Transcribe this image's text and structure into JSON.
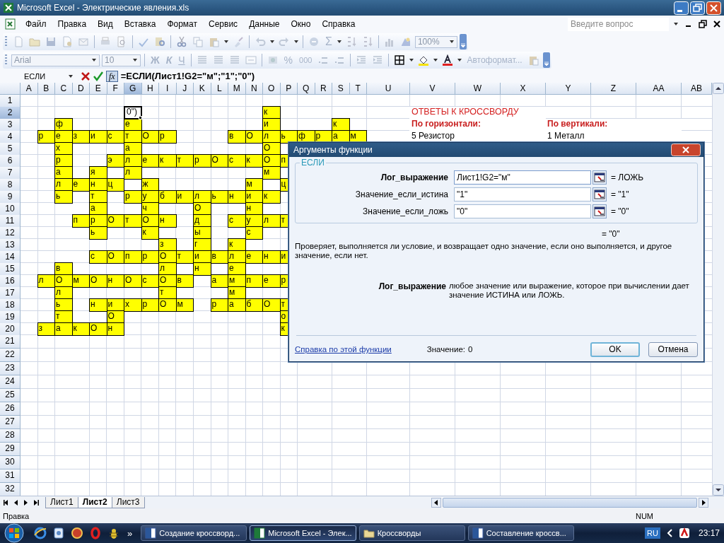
{
  "window": {
    "title": "Microsoft Excel - Электрические явления.xls"
  },
  "menu": {
    "items": [
      "Файл",
      "Правка",
      "Вид",
      "Вставка",
      "Формат",
      "Сервис",
      "Данные",
      "Окно",
      "Справка"
    ],
    "question_box": {
      "placeholder": "Введите вопрос"
    }
  },
  "standard_toolbar": {
    "disabled": true,
    "sigma": "Σ",
    "zoom": "100%"
  },
  "formatting_toolbar": {
    "disabled": true,
    "font": "Arial",
    "size": "10",
    "bold": "Ж",
    "italic": "К",
    "underline": "Ч",
    "percent": "%",
    "thousands": "000",
    "autoformat": "Автоформат..."
  },
  "formula_bar": {
    "name_box": "ЕСЛИ",
    "fx": "fx",
    "formula": "=ЕСЛИ(Лист1!G2=\"м\";\"1\";\"0\")"
  },
  "sheet": {
    "columns": [
      "A",
      "B",
      "C",
      "D",
      "E",
      "F",
      "G",
      "H",
      "I",
      "J",
      "K",
      "L",
      "M",
      "N",
      "O",
      "P",
      "Q",
      "R",
      "S",
      "T",
      "U",
      "V",
      "W",
      "X",
      "Y",
      "Z",
      "AA",
      "AB"
    ],
    "rows": [
      {
        "label": "1"
      },
      {
        "label": "2",
        "cells": [
          {
            "kind": "blank"
          },
          {
            "kind": "blank"
          },
          {
            "kind": "blank"
          },
          {
            "kind": "blank"
          },
          {
            "kind": "blank"
          },
          {
            "kind": "blank"
          },
          {
            "kind": "active",
            "text": "0\")"
          },
          {
            "kind": "blank"
          },
          {
            "kind": "blank"
          },
          {
            "kind": "blank"
          },
          {
            "kind": "blank"
          },
          {
            "kind": "blank"
          },
          {
            "kind": "blank"
          },
          {
            "kind": "blank"
          },
          {
            "kind": "letter",
            "text": "к"
          },
          {
            "kind": "blank"
          },
          {
            "kind": "blank"
          },
          {
            "kind": "blank"
          },
          {
            "kind": "blank"
          },
          {
            "kind": "blank"
          },
          {
            "kind": "blank"
          },
          {
            "kind": "title",
            "text": "ОТВЕТЫ К КРОССВОРДУ"
          }
        ]
      },
      {
        "label": "3",
        "cells": [
          {
            "kind": "blank"
          },
          {
            "kind": "blank"
          },
          {
            "kind": "letter",
            "text": "ф"
          },
          {
            "kind": "blank"
          },
          {
            "kind": "blank"
          },
          {
            "kind": "blank"
          },
          {
            "kind": "letter",
            "text": "е"
          },
          {
            "kind": "blank"
          },
          {
            "kind": "blank"
          },
          {
            "kind": "blank"
          },
          {
            "kind": "blank"
          },
          {
            "kind": "blank"
          },
          {
            "kind": "blank"
          },
          {
            "kind": "blank"
          },
          {
            "kind": "letter",
            "text": "и"
          },
          {
            "kind": "blank"
          },
          {
            "kind": "blank"
          },
          {
            "kind": "blank"
          },
          {
            "kind": "letter",
            "text": "к"
          },
          {
            "kind": "blank"
          },
          {
            "kind": "blank"
          },
          {
            "kind": "heading",
            "text": "По горизонтали:"
          },
          {
            "kind": "blank"
          },
          {
            "kind": "blank"
          },
          {
            "kind": "heading",
            "text": "По вертикали:"
          }
        ]
      },
      {
        "label": "4",
        "cells": [
          {
            "kind": "blank"
          },
          {
            "kind": "letter",
            "text": "р"
          },
          {
            "kind": "letter",
            "text": "е"
          },
          {
            "kind": "letter",
            "text": "з"
          },
          {
            "kind": "letter",
            "text": "и"
          },
          {
            "kind": "letter",
            "text": "с"
          },
          {
            "kind": "letter",
            "text": "т"
          },
          {
            "kind": "letter",
            "text": "О"
          },
          {
            "kind": "letter",
            "text": "р"
          },
          {
            "kind": "blank"
          },
          {
            "kind": "blank"
          },
          {
            "kind": "blank"
          },
          {
            "kind": "letter",
            "text": "в"
          },
          {
            "kind": "letter",
            "text": "О"
          },
          {
            "kind": "letter",
            "text": "л"
          },
          {
            "kind": "letter",
            "text": "ь"
          },
          {
            "kind": "letter",
            "text": "ф"
          },
          {
            "kind": "letter",
            "text": "р"
          },
          {
            "kind": "letter",
            "text": "а"
          },
          {
            "kind": "letter",
            "text": "м"
          },
          {
            "kind": "blank"
          },
          {
            "kind": "plain",
            "text": "5 Резистор"
          },
          {
            "kind": "blank"
          },
          {
            "kind": "blank"
          },
          {
            "kind": "plain",
            "text": "1 Металл"
          }
        ]
      },
      {
        "label": "5",
        "cells": [
          {
            "kind": "blank"
          },
          {
            "kind": "blank"
          },
          {
            "kind": "letter",
            "text": "х"
          },
          {
            "kind": "blank"
          },
          {
            "kind": "blank"
          },
          {
            "kind": "blank"
          },
          {
            "kind": "letter",
            "text": "а"
          },
          {
            "kind": "blank"
          },
          {
            "kind": "blank"
          },
          {
            "kind": "blank"
          },
          {
            "kind": "blank"
          },
          {
            "kind": "blank"
          },
          {
            "kind": "blank"
          },
          {
            "kind": "blank"
          },
          {
            "kind": "letter",
            "text": "О"
          }
        ]
      },
      {
        "label": "6",
        "cells": [
          {
            "kind": "blank"
          },
          {
            "kind": "blank"
          },
          {
            "kind": "letter",
            "text": "р"
          },
          {
            "kind": "blank"
          },
          {
            "kind": "blank"
          },
          {
            "kind": "letter",
            "text": "э"
          },
          {
            "kind": "letter",
            "text": "л"
          },
          {
            "kind": "letter",
            "text": "е"
          },
          {
            "kind": "letter",
            "text": "к"
          },
          {
            "kind": "letter",
            "text": "т"
          },
          {
            "kind": "letter",
            "text": "р"
          },
          {
            "kind": "letter",
            "text": "О"
          },
          {
            "kind": "letter",
            "text": "с"
          },
          {
            "kind": "letter",
            "text": "к"
          },
          {
            "kind": "letter",
            "text": "О"
          },
          {
            "kind": "letter",
            "text": "п"
          }
        ]
      },
      {
        "label": "7",
        "cells": [
          {
            "kind": "blank"
          },
          {
            "kind": "blank"
          },
          {
            "kind": "letter",
            "text": "а"
          },
          {
            "kind": "blank"
          },
          {
            "kind": "letter",
            "text": "я"
          },
          {
            "kind": "blank"
          },
          {
            "kind": "letter",
            "text": "л"
          },
          {
            "kind": "blank"
          },
          {
            "kind": "blank"
          },
          {
            "kind": "blank"
          },
          {
            "kind": "blank"
          },
          {
            "kind": "blank"
          },
          {
            "kind": "blank"
          },
          {
            "kind": "blank"
          },
          {
            "kind": "letter",
            "text": "м"
          }
        ]
      },
      {
        "label": "8",
        "cells": [
          {
            "kind": "blank"
          },
          {
            "kind": "blank"
          },
          {
            "kind": "letter",
            "text": "л"
          },
          {
            "kind": "letter",
            "text": "е"
          },
          {
            "kind": "letter",
            "text": "н"
          },
          {
            "kind": "letter",
            "text": "ц"
          },
          {
            "kind": "blank"
          },
          {
            "kind": "letter",
            "text": "ж"
          },
          {
            "kind": "blank"
          },
          {
            "kind": "blank"
          },
          {
            "kind": "blank"
          },
          {
            "kind": "blank"
          },
          {
            "kind": "blank"
          },
          {
            "kind": "letter",
            "text": "м"
          },
          {
            "kind": "blank"
          },
          {
            "kind": "letter",
            "text": "ц"
          }
        ]
      },
      {
        "label": "9",
        "cells": [
          {
            "kind": "blank"
          },
          {
            "kind": "blank"
          },
          {
            "kind": "letter",
            "text": "ь"
          },
          {
            "kind": "blank"
          },
          {
            "kind": "letter",
            "text": "т"
          },
          {
            "kind": "blank"
          },
          {
            "kind": "letter",
            "text": "р"
          },
          {
            "kind": "letter",
            "text": "у"
          },
          {
            "kind": "letter",
            "text": "б"
          },
          {
            "kind": "letter",
            "text": "и"
          },
          {
            "kind": "letter",
            "text": "л"
          },
          {
            "kind": "letter",
            "text": "ь"
          },
          {
            "kind": "letter",
            "text": "н"
          },
          {
            "kind": "letter",
            "text": "и"
          },
          {
            "kind": "letter",
            "text": "к"
          }
        ]
      },
      {
        "label": "10",
        "cells": [
          {
            "kind": "blank"
          },
          {
            "kind": "blank"
          },
          {
            "kind": "blank"
          },
          {
            "kind": "blank"
          },
          {
            "kind": "letter",
            "text": "а"
          },
          {
            "kind": "blank"
          },
          {
            "kind": "blank"
          },
          {
            "kind": "letter",
            "text": "ч"
          },
          {
            "kind": "blank"
          },
          {
            "kind": "blank"
          },
          {
            "kind": "letter",
            "text": "О"
          },
          {
            "kind": "blank"
          },
          {
            "kind": "blank"
          },
          {
            "kind": "letter",
            "text": "н"
          }
        ]
      },
      {
        "label": "11",
        "cells": [
          {
            "kind": "blank"
          },
          {
            "kind": "blank"
          },
          {
            "kind": "blank"
          },
          {
            "kind": "letter",
            "text": "п"
          },
          {
            "kind": "letter",
            "text": "р"
          },
          {
            "kind": "letter",
            "text": "О"
          },
          {
            "kind": "letter",
            "text": "т"
          },
          {
            "kind": "letter",
            "text": "О"
          },
          {
            "kind": "letter",
            "text": "н"
          },
          {
            "kind": "blank"
          },
          {
            "kind": "letter",
            "text": "д"
          },
          {
            "kind": "blank"
          },
          {
            "kind": "letter",
            "text": "с"
          },
          {
            "kind": "letter",
            "text": "у"
          },
          {
            "kind": "letter",
            "text": "л"
          },
          {
            "kind": "letter",
            "text": "т"
          }
        ]
      },
      {
        "label": "12",
        "cells": [
          {
            "kind": "blank"
          },
          {
            "kind": "blank"
          },
          {
            "kind": "blank"
          },
          {
            "kind": "blank"
          },
          {
            "kind": "letter",
            "text": "ь"
          },
          {
            "kind": "blank"
          },
          {
            "kind": "blank"
          },
          {
            "kind": "letter",
            "text": "к"
          },
          {
            "kind": "blank"
          },
          {
            "kind": "blank"
          },
          {
            "kind": "letter",
            "text": "ы"
          },
          {
            "kind": "blank"
          },
          {
            "kind": "blank"
          },
          {
            "kind": "letter",
            "text": "с"
          }
        ]
      },
      {
        "label": "13",
        "cells": [
          {
            "kind": "blank"
          },
          {
            "kind": "blank"
          },
          {
            "kind": "blank"
          },
          {
            "kind": "blank"
          },
          {
            "kind": "blank"
          },
          {
            "kind": "blank"
          },
          {
            "kind": "blank"
          },
          {
            "kind": "blank"
          },
          {
            "kind": "letter",
            "text": "з"
          },
          {
            "kind": "blank"
          },
          {
            "kind": "letter",
            "text": "г"
          },
          {
            "kind": "blank"
          },
          {
            "kind": "letter",
            "text": "к"
          }
        ]
      },
      {
        "label": "14",
        "cells": [
          {
            "kind": "blank"
          },
          {
            "kind": "blank"
          },
          {
            "kind": "blank"
          },
          {
            "kind": "blank"
          },
          {
            "kind": "letter",
            "text": "с"
          },
          {
            "kind": "letter",
            "text": "О"
          },
          {
            "kind": "letter",
            "text": "п"
          },
          {
            "kind": "letter",
            "text": "р"
          },
          {
            "kind": "letter",
            "text": "О"
          },
          {
            "kind": "letter",
            "text": "т"
          },
          {
            "kind": "letter",
            "text": "и"
          },
          {
            "kind": "letter",
            "text": "в"
          },
          {
            "kind": "letter",
            "text": "л"
          },
          {
            "kind": "letter",
            "text": "е"
          },
          {
            "kind": "letter",
            "text": "н"
          },
          {
            "kind": "letter",
            "text": "и"
          }
        ]
      },
      {
        "label": "15",
        "cells": [
          {
            "kind": "blank"
          },
          {
            "kind": "blank"
          },
          {
            "kind": "letter",
            "text": "в"
          },
          {
            "kind": "blank"
          },
          {
            "kind": "blank"
          },
          {
            "kind": "blank"
          },
          {
            "kind": "blank"
          },
          {
            "kind": "blank"
          },
          {
            "kind": "letter",
            "text": "л"
          },
          {
            "kind": "blank"
          },
          {
            "kind": "letter",
            "text": "н"
          },
          {
            "kind": "blank"
          },
          {
            "kind": "letter",
            "text": "е"
          }
        ]
      },
      {
        "label": "16",
        "cells": [
          {
            "kind": "blank"
          },
          {
            "kind": "letter",
            "text": "л"
          },
          {
            "kind": "letter",
            "text": "О"
          },
          {
            "kind": "letter",
            "text": "м"
          },
          {
            "kind": "letter",
            "text": "О"
          },
          {
            "kind": "letter",
            "text": "н"
          },
          {
            "kind": "letter",
            "text": "О"
          },
          {
            "kind": "letter",
            "text": "с"
          },
          {
            "kind": "letter",
            "text": "О"
          },
          {
            "kind": "letter",
            "text": "в"
          },
          {
            "kind": "blank"
          },
          {
            "kind": "letter",
            "text": "а"
          },
          {
            "kind": "letter",
            "text": "м"
          },
          {
            "kind": "letter",
            "text": "п"
          },
          {
            "kind": "letter",
            "text": "е"
          },
          {
            "kind": "letter",
            "text": "р"
          }
        ]
      },
      {
        "label": "17",
        "cells": [
          {
            "kind": "blank"
          },
          {
            "kind": "blank"
          },
          {
            "kind": "letter",
            "text": "л"
          },
          {
            "kind": "blank"
          },
          {
            "kind": "blank"
          },
          {
            "kind": "blank"
          },
          {
            "kind": "blank"
          },
          {
            "kind": "blank"
          },
          {
            "kind": "letter",
            "text": "т"
          },
          {
            "kind": "blank"
          },
          {
            "kind": "blank"
          },
          {
            "kind": "blank"
          },
          {
            "kind": "letter",
            "text": "м"
          }
        ]
      },
      {
        "label": "18",
        "cells": [
          {
            "kind": "blank"
          },
          {
            "kind": "blank"
          },
          {
            "kind": "letter",
            "text": "ь"
          },
          {
            "kind": "blank"
          },
          {
            "kind": "letter",
            "text": "н"
          },
          {
            "kind": "letter",
            "text": "и"
          },
          {
            "kind": "letter",
            "text": "х"
          },
          {
            "kind": "letter",
            "text": "р"
          },
          {
            "kind": "letter",
            "text": "О"
          },
          {
            "kind": "letter",
            "text": "м"
          },
          {
            "kind": "blank"
          },
          {
            "kind": "letter",
            "text": "р"
          },
          {
            "kind": "letter",
            "text": "а"
          },
          {
            "kind": "letter",
            "text": "б"
          },
          {
            "kind": "letter",
            "text": "О"
          },
          {
            "kind": "letter",
            "text": "т"
          }
        ]
      },
      {
        "label": "19",
        "cells": [
          {
            "kind": "blank"
          },
          {
            "kind": "blank"
          },
          {
            "kind": "letter",
            "text": "т"
          },
          {
            "kind": "blank"
          },
          {
            "kind": "blank"
          },
          {
            "kind": "letter",
            "text": "О"
          },
          {
            "kind": "blank"
          },
          {
            "kind": "blank"
          },
          {
            "kind": "blank"
          },
          {
            "kind": "blank"
          },
          {
            "kind": "blank"
          },
          {
            "kind": "blank"
          },
          {
            "kind": "blank"
          },
          {
            "kind": "blank"
          },
          {
            "kind": "blank"
          },
          {
            "kind": "letter",
            "text": "о"
          }
        ]
      },
      {
        "label": "20",
        "cells": [
          {
            "kind": "blank"
          },
          {
            "kind": "letter",
            "text": "з"
          },
          {
            "kind": "letter",
            "text": "а"
          },
          {
            "kind": "letter",
            "text": "к"
          },
          {
            "kind": "letter",
            "text": "О"
          },
          {
            "kind": "letter",
            "text": "н"
          },
          {
            "kind": "blank"
          },
          {
            "kind": "blank"
          },
          {
            "kind": "blank"
          },
          {
            "kind": "blank"
          },
          {
            "kind": "blank"
          },
          {
            "kind": "blank"
          },
          {
            "kind": "blank"
          },
          {
            "kind": "blank"
          },
          {
            "kind": "blank"
          },
          {
            "kind": "letter",
            "text": "к"
          }
        ]
      },
      {
        "label": "21"
      },
      {
        "label": "22"
      },
      {
        "label": "23"
      },
      {
        "label": "24"
      },
      {
        "label": "25"
      },
      {
        "label": "26"
      },
      {
        "label": "27"
      },
      {
        "label": "28"
      },
      {
        "label": "29"
      },
      {
        "label": "30"
      },
      {
        "label": "31"
      },
      {
        "label": "32"
      }
    ]
  },
  "dialog": {
    "title": "Аргументы функции",
    "function": "ЕСЛИ",
    "arguments": [
      {
        "label": "Лог_выражение",
        "value": "Лист1!G2=\"м\"",
        "result": "= ЛОЖЬ",
        "selected": true
      },
      {
        "label": "Значение_если_истина",
        "value": "\"1\"",
        "result": "= \"1\"",
        "selected": false
      },
      {
        "label": "Значение_если_ложь",
        "value": "\"0\"",
        "result": "= \"0\"",
        "selected": false
      }
    ],
    "result": "= \"0\"",
    "description": "Проверяет, выполняется ли условие, и возвращает одно значение, если оно выполняется, и другое значение, если нет.",
    "argument_help": {
      "label": "Лог_выражение",
      "text": "любое значение или выражение, которое при вычислении дает значение ИСТИНА или ЛОЖЬ."
    },
    "help_link": "Справка по этой функции",
    "value_label": "Значение:",
    "value": "0",
    "buttons": [
      {
        "label": "OK",
        "selected": true
      },
      {
        "label": "Отмена",
        "selected": false
      }
    ]
  },
  "sheet_tabs": [
    {
      "label": "Лист1",
      "selected": false
    },
    {
      "label": "Лист2",
      "selected": true
    },
    {
      "label": "Лист3",
      "selected": false
    }
  ],
  "status_bar": {
    "mode": "Правка",
    "indicator": "NUM"
  },
  "taskbar": {
    "overflow": "»",
    "tasks": [
      {
        "kind": "word",
        "label": "Создание кроссворд...",
        "selected": false
      },
      {
        "kind": "excel",
        "label": "Microsoft Excel - Элек...",
        "selected": true
      },
      {
        "kind": "folder",
        "label": "Кроссворды",
        "selected": false
      },
      {
        "kind": "word",
        "label": "Составление кроссв...",
        "selected": false
      }
    ],
    "language": "RU",
    "time": "23:17"
  }
}
